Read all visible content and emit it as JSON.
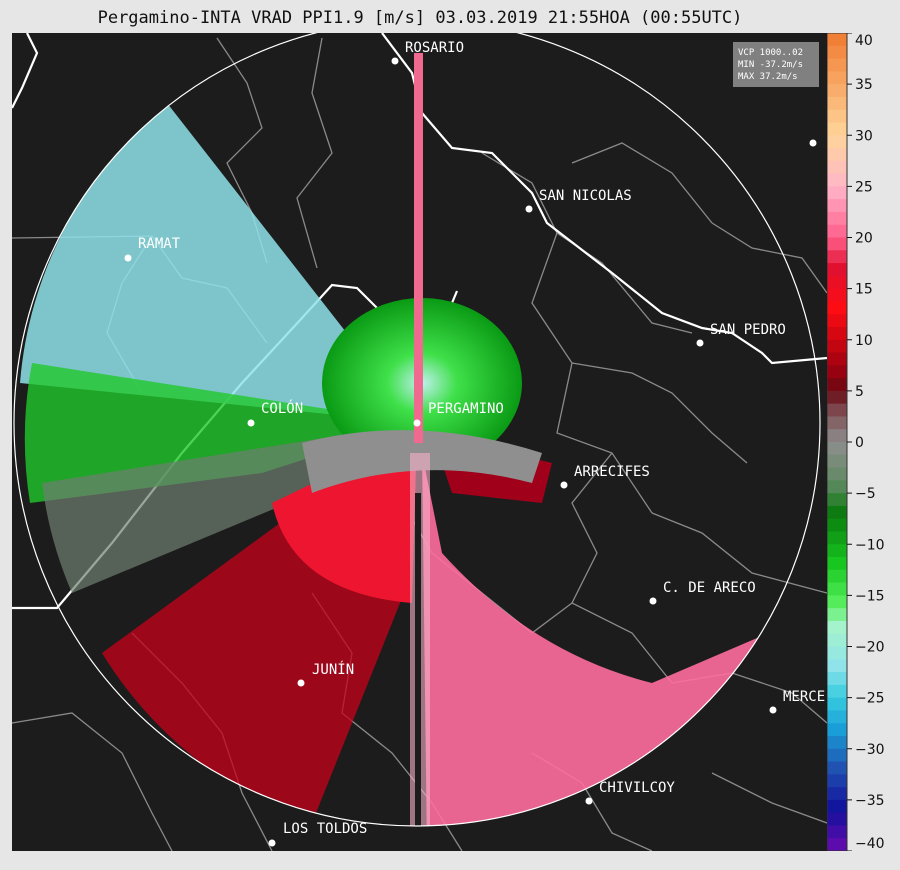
{
  "title": "Pergamino-INTA VRAD PPI1.9 [m/s] 03.03.2019 21:55HOA (00:55UTC)",
  "stats": {
    "vcp": "VCP 1000..02",
    "min": "MIN -37.2m/s",
    "max": "MAX 37.2m/s"
  },
  "colorbar": {
    "min": -40,
    "max": 40,
    "ticks": [
      40,
      35,
      30,
      25,
      20,
      15,
      10,
      5,
      0,
      -5,
      -10,
      -15,
      -20,
      -25,
      -30,
      -35,
      -40
    ],
    "tick_labels": [
      "40",
      "35",
      "30",
      "25",
      "20",
      "15",
      "10",
      "5",
      "0",
      "−5",
      "−10",
      "−15",
      "−20",
      "−25",
      "−30",
      "−35",
      "−40"
    ]
  },
  "cities": [
    {
      "name": "ROSARIO"
    },
    {
      "name": "SAN NICOLAS"
    },
    {
      "name": "RAMAT"
    },
    {
      "name": "SAN PEDRO"
    },
    {
      "name": "COLÓN"
    },
    {
      "name": "PERGAMINO"
    },
    {
      "name": "ARRECIFES"
    },
    {
      "name": "C. DE ARECO"
    },
    {
      "name": "JUNÍN"
    },
    {
      "name": "MERCE"
    },
    {
      "name": "CHIVILCOY"
    },
    {
      "name": "LOS TOLDOS"
    }
  ]
}
